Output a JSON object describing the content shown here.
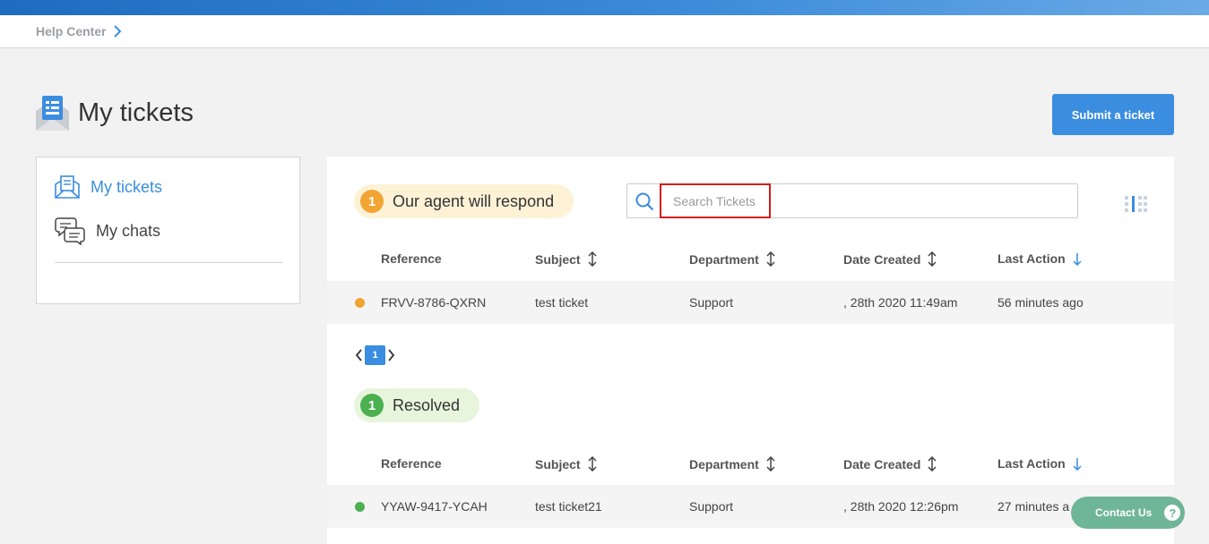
{
  "breadcrumb": {
    "label": "Help Center"
  },
  "header": {
    "title": "My tickets",
    "submit_label": "Submit a ticket"
  },
  "sidebar": {
    "items": [
      {
        "label": "My tickets",
        "active": true
      },
      {
        "label": "My chats",
        "active": false
      }
    ]
  },
  "search": {
    "placeholder": "Search Tickets"
  },
  "columns": [
    "Reference",
    "Subject",
    "Department",
    "Date Created",
    "Last Action"
  ],
  "sections": [
    {
      "status": "Our agent will respond",
      "count": "1",
      "color": "#f2a533",
      "rows": [
        {
          "reference": "FRVV-8786-QXRN",
          "subject": "test ticket",
          "department": "Support",
          "date_created": ", 28th 2020 11:49am",
          "last_action": "56 minutes ago"
        }
      ]
    },
    {
      "status": "Resolved",
      "count": "1",
      "color": "#4caf50",
      "rows": [
        {
          "reference": "YYAW-9417-YCAH",
          "subject": "test ticket21",
          "department": "Support",
          "date_created": ", 28th 2020 12:26pm",
          "last_action": "27 minutes a"
        }
      ]
    }
  ],
  "pagination": {
    "current_page": "1"
  },
  "contact": {
    "label": "Contact Us",
    "help_glyph": "?"
  },
  "colors": {
    "accent": "#3b8de0",
    "pending": "#f2a533",
    "resolved": "#4caf50",
    "contact": "#6fb597",
    "search_highlight": "#d81b1b"
  }
}
